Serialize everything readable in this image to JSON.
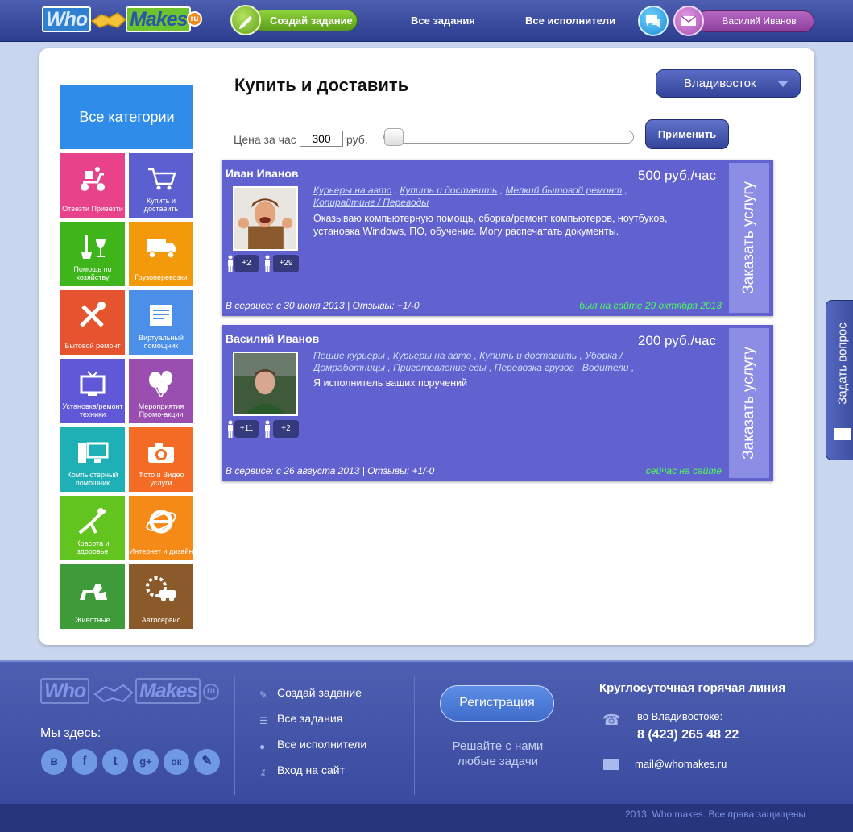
{
  "header": {
    "logo": {
      "who": "Who",
      "makes": "Makes",
      "ru": "ru"
    },
    "create_task": "Создай задание",
    "all_tasks": "Все задания",
    "all_executors": "Все исполнители",
    "user_name": "Василий Иванов"
  },
  "sidebar": {
    "all_categories": "Все категории",
    "tiles": [
      {
        "label": "Отвезти Привезти",
        "color": "#e8428a",
        "icon": "scooter-icon"
      },
      {
        "label": "Купить и доставить",
        "color": "#5b5fd0",
        "icon": "cart-icon"
      },
      {
        "label": "Помощь по хозяйству",
        "color": "#3eb51b",
        "icon": "mop-icon"
      },
      {
        "label": "Грузоперевозки",
        "color": "#f29a0a",
        "icon": "truck-icon"
      },
      {
        "label": "Бытовой ремонт",
        "color": "#e5542e",
        "icon": "tools-icon"
      },
      {
        "label": "Виртуальный помощник",
        "color": "#4b8fe8",
        "icon": "document-icon"
      },
      {
        "label": "Установка/ремонт техники",
        "color": "#6158d8",
        "icon": "tv-icon"
      },
      {
        "label": "Мероприятия Промо-акции",
        "color": "#9a4fb0",
        "icon": "balloons-icon"
      },
      {
        "label": "Компьютерный помошник",
        "color": "#1eb0b5",
        "icon": "computer-icon"
      },
      {
        "label": "Фото и Видео услуги",
        "color": "#f36b25",
        "icon": "camera-icon"
      },
      {
        "label": "Красота и здоровье",
        "color": "#62c41f",
        "icon": "yoga-icon"
      },
      {
        "label": "Интернет и дизайн",
        "color": "#f58a16",
        "icon": "ie-icon"
      },
      {
        "label": "Животные",
        "color": "#3f9a3a",
        "icon": "pets-icon"
      },
      {
        "label": "Автосервис",
        "color": "#8a5a2a",
        "icon": "car-service-icon"
      }
    ]
  },
  "main": {
    "title": "Купить и доставить",
    "city": "Владивосток",
    "price_label": "Цена за час",
    "price_value": "300",
    "price_unit": "руб.",
    "slider_level": 0,
    "apply": "Применить"
  },
  "executors": [
    {
      "name": "Иван Иванов",
      "price": "500 руб./час",
      "categories": [
        "Курьеры на авто",
        "Купить и доставить",
        "Мелкий бытовой ремонт",
        "Копирайтинг / Переводы"
      ],
      "description": "Оказываю компьютерную помощь, сборка/ремонт компьютеров, ноутбуков, установка Windows, ПО, обучение. Могу распечатать документы.",
      "positive": "+2",
      "negative": "+29",
      "since": "В сервисе: с 30 июня 2013 | Отзывы: +1/-0",
      "online": "был на сайте 29 октября 2013",
      "order": "Заказать услугу"
    },
    {
      "name": "Василий Иванов",
      "price": "200 руб./час",
      "categories": [
        "Пешие курьеры",
        "Курьеры на авто",
        "Купить и доставить",
        "Уборка / Домработницы",
        "Приготовление еды",
        "Перевозка грузов",
        "Водители"
      ],
      "description": "Я исполнитель ваших поручений",
      "positive": "+11",
      "negative": "+2",
      "since": "В сервисе: с 26 августа 2013 | Отзывы: +1/-0",
      "online": "сейчас на сайте",
      "order": "Заказать услугу"
    }
  ],
  "ask_question": "Задать вопрос",
  "footer": {
    "we_are_here": "Мы здесь:",
    "social": [
      "в",
      "f",
      "t",
      "g+",
      "ок",
      "✎"
    ],
    "links": [
      "Создай задание",
      "Все задания",
      "Все исполнители",
      "Вход на сайт"
    ],
    "register": "Регистрация",
    "slogan": "Решайте с нами любые задачи",
    "hotline_title": "Круглосуточная горячая линия",
    "city": "во Владивостоке:",
    "phone": "8 (423) 265 48 22",
    "email": "mail@whomakes.ru",
    "copyright": "2013. Who makes. Все права защищены"
  }
}
